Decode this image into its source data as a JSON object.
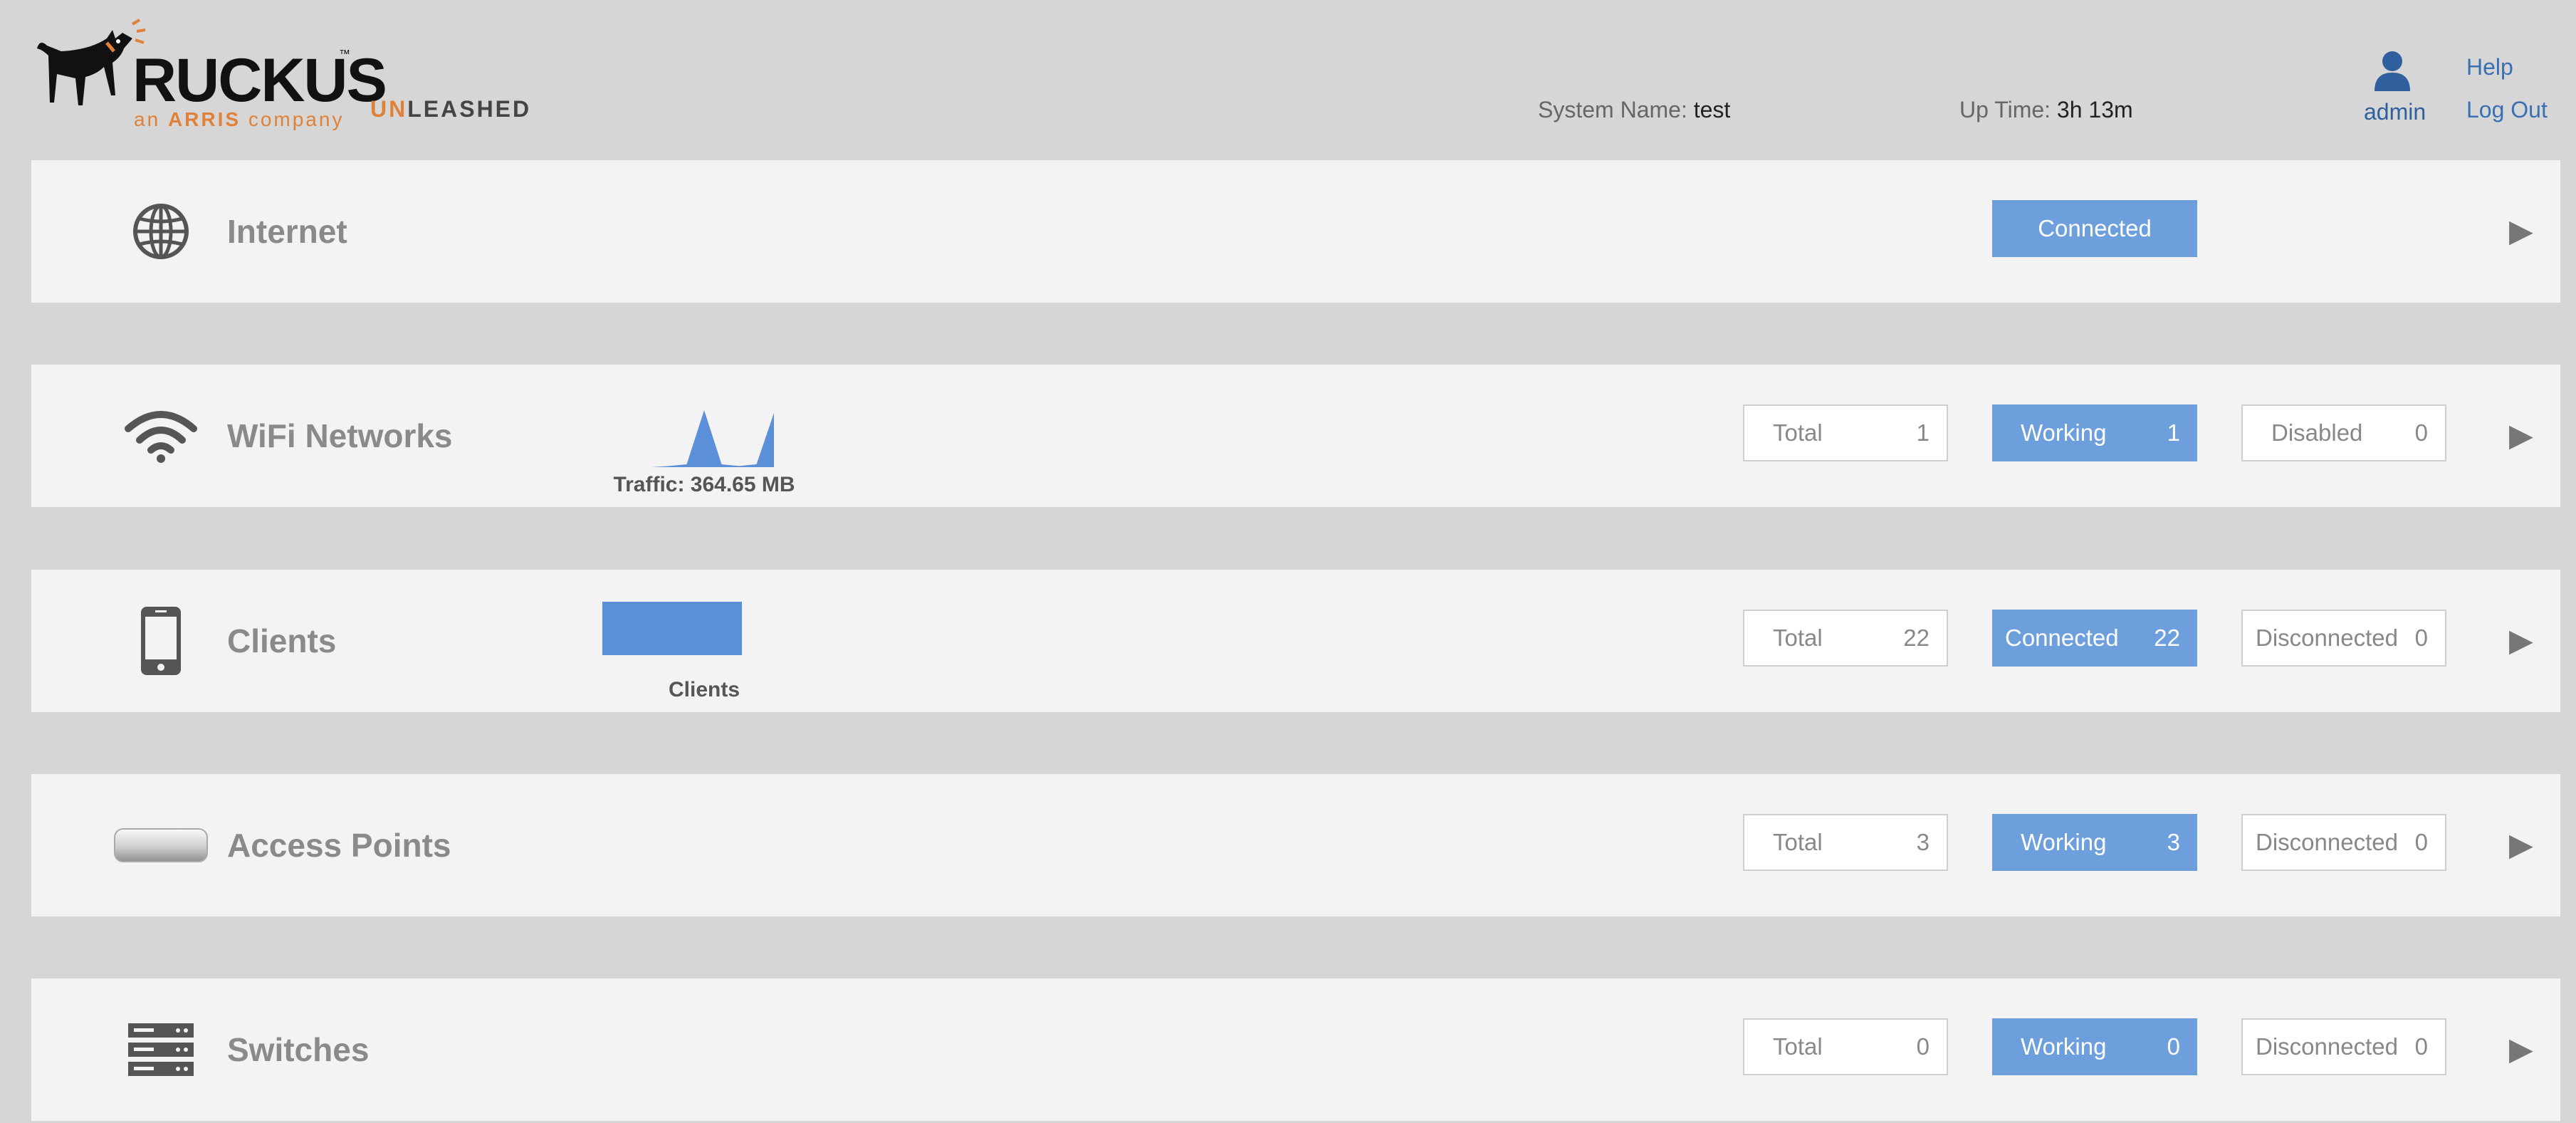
{
  "brand": {
    "logo_word": "RUCKUS",
    "logo_tm": "™",
    "logo_sub_pre": "an ",
    "logo_sub_arris": "ARRIS",
    "logo_sub_post": " company",
    "product_un": "UN",
    "product_rest": "LEASHED"
  },
  "header": {
    "system_name_label": "System Name:",
    "system_name_value": "test",
    "uptime_label": "Up Time:",
    "uptime_value": "3h 13m",
    "user": "admin",
    "help": "Help",
    "logout": "Log Out"
  },
  "icons": {
    "user": "user-icon",
    "internet": "globe-icon",
    "wifi": "wifi-icon",
    "clients": "phone-icon",
    "aps": "access-point-icon",
    "switches": "switch-stack-icon",
    "arrow": "play-arrow-icon"
  },
  "colors": {
    "accent_blue": "#6d9fdd",
    "chart_blue": "#5b8fd8",
    "brand_orange": "#e0813a",
    "link_blue": "#3a6fb4"
  },
  "internet": {
    "title": "Internet",
    "status": "Connected",
    "arrow": "▶"
  },
  "wifi": {
    "title": "WiFi Networks",
    "traffic_label": "Traffic: 364.65 MB",
    "traffic_spark": [
      0,
      0,
      0.02,
      0.05,
      1.0,
      0.05,
      0.02,
      0.05,
      0.95
    ],
    "total_label": "Total",
    "total_value": "1",
    "working_label": "Working",
    "working_value": "1",
    "disabled_label": "Disabled",
    "disabled_value": "0",
    "arrow": "▶"
  },
  "clients": {
    "title": "Clients",
    "chart_label": "Clients",
    "chart_fill": 1.0,
    "total_label": "Total",
    "total_value": "22",
    "connected_label": "Connected",
    "connected_value": "22",
    "disconnected_label": "Disconnected",
    "disconnected_value": "0",
    "arrow": "▶"
  },
  "aps": {
    "title": "Access Points",
    "total_label": "Total",
    "total_value": "3",
    "working_label": "Working",
    "working_value": "3",
    "disconnected_label": "Disconnected",
    "disconnected_value": "0",
    "arrow": "▶"
  },
  "switches": {
    "title": "Switches",
    "total_label": "Total",
    "total_value": "0",
    "working_label": "Working",
    "working_value": "0",
    "disconnected_label": "Disconnected",
    "disconnected_value": "0",
    "arrow": "▶"
  }
}
